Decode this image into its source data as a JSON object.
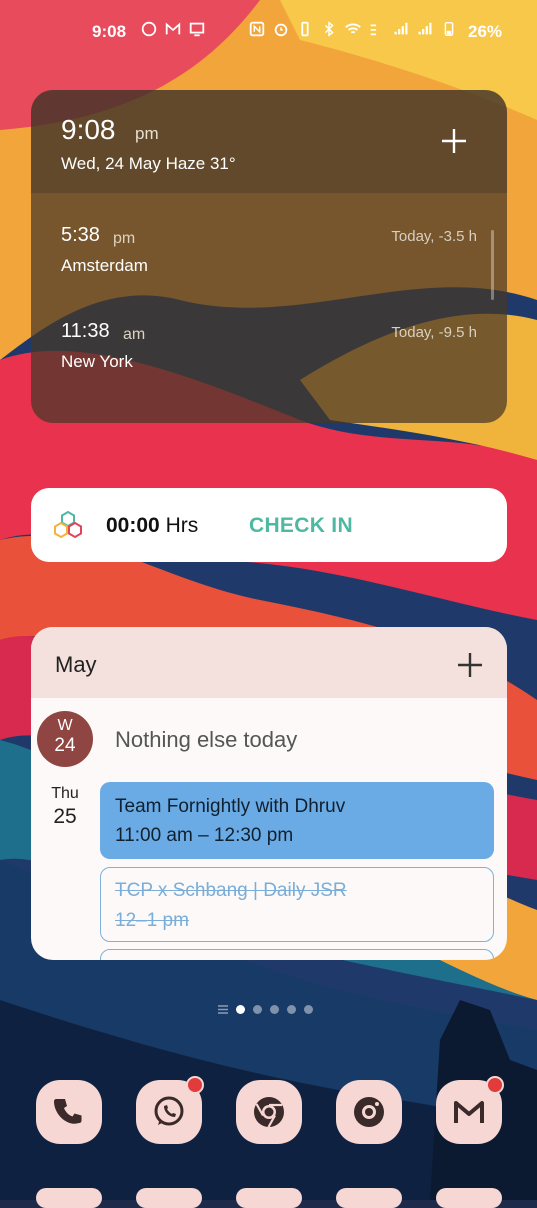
{
  "status_bar": {
    "time": "9:08",
    "battery": "26%"
  },
  "clock_widget": {
    "time": "9:08",
    "ampm": "pm",
    "date_weather": "Wed, 24 May  Haze 31°",
    "cities": [
      {
        "time": "5:38",
        "ampm": "pm",
        "name": "Amsterdam",
        "offset": "Today, -3.5 h"
      },
      {
        "time": "11:38",
        "ampm": "am",
        "name": "New York",
        "offset": "Today, -9.5 h"
      }
    ]
  },
  "checkin_widget": {
    "hours_bold": "00:00",
    "hours_unit": "Hrs",
    "button_label": "CHECK IN",
    "accent": "#4fb8a0"
  },
  "calendar_widget": {
    "month": "May",
    "today": {
      "weekday": "W",
      "day": "24",
      "message": "Nothing else today"
    },
    "next_day": {
      "weekday": "Thu",
      "day": "25"
    },
    "events": [
      {
        "title": "Team Fornightly with Dhruv",
        "time": "11:00 am – 12:30 pm",
        "color": "#6aabe6"
      },
      {
        "title": "TCP x Schbang | Daily JSR",
        "time": "12–1 pm",
        "declined": true
      }
    ]
  },
  "dock": {
    "apps": [
      "phone-icon",
      "whatsapp-icon",
      "chrome-icon",
      "camera-icon",
      "gmail-icon"
    ]
  }
}
